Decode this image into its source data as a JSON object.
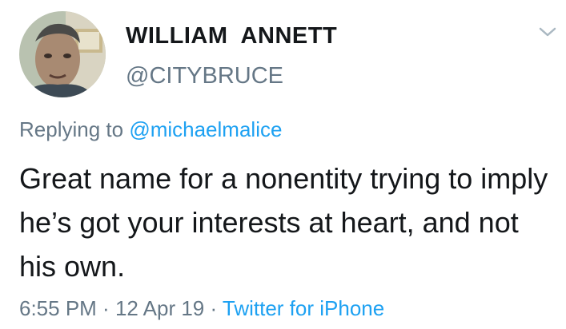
{
  "user": {
    "display_name": "WILLIAM  ANNETT",
    "handle": "@CITYBRUCE",
    "avatar_icon": "user-avatar"
  },
  "menu": {
    "icon": "chevron-down-icon"
  },
  "reply": {
    "prefix": "Replying to ",
    "mention": "@michaelmalice"
  },
  "tweet": {
    "text": "Great name for a nonentity trying to imply he’s got your interests at heart, and not his own."
  },
  "meta": {
    "time": "6:55 PM",
    "separator_1": " · ",
    "date": "12 Apr 19",
    "separator_2": " · ",
    "source": "Twitter for iPhone"
  },
  "colors": {
    "text": "#14171a",
    "secondary": "#657786",
    "link": "#1da1f2"
  }
}
